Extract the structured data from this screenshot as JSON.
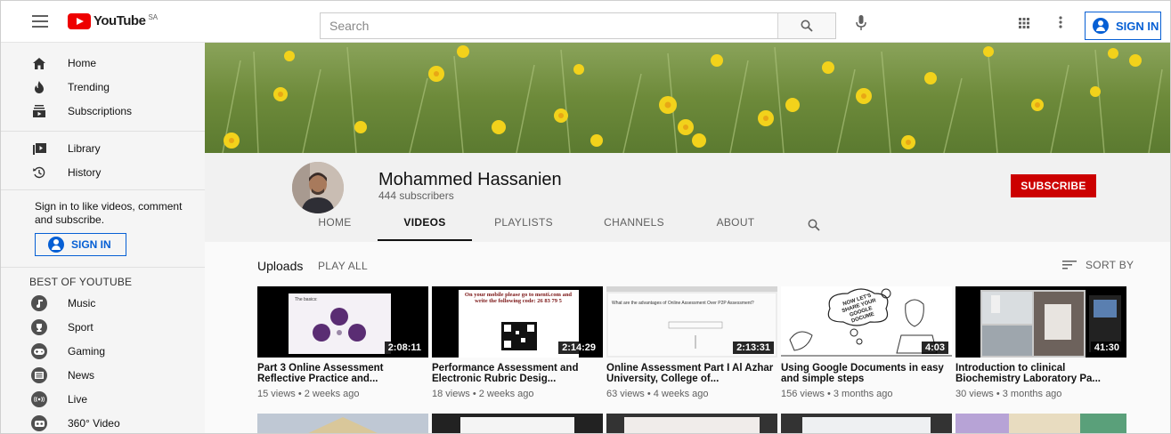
{
  "header": {
    "logo_text": "YouTube",
    "country_code": "SA",
    "search_placeholder": "Search",
    "signin_label": "SIGN IN"
  },
  "sidebar": {
    "main_items": [
      {
        "label": "Home",
        "icon": "home-icon"
      },
      {
        "label": "Trending",
        "icon": "flame-icon"
      },
      {
        "label": "Subscriptions",
        "icon": "subscriptions-icon"
      }
    ],
    "library_items": [
      {
        "label": "Library",
        "icon": "library-icon"
      },
      {
        "label": "History",
        "icon": "history-icon"
      }
    ],
    "signin_prompt": "Sign in to like videos, comment and subscribe.",
    "signin_label": "SIGN IN",
    "best_of_heading": "BEST OF YOUTUBE",
    "best_of_items": [
      {
        "label": "Music",
        "icon": "music-icon"
      },
      {
        "label": "Sport",
        "icon": "sport-icon"
      },
      {
        "label": "Gaming",
        "icon": "gaming-icon"
      },
      {
        "label": "News",
        "icon": "news-icon"
      },
      {
        "label": "Live",
        "icon": "live-icon"
      },
      {
        "label": "360° Video",
        "icon": "360-video-icon"
      }
    ]
  },
  "channel": {
    "name": "Mohammed Hassanien",
    "subscribers": "444 subscribers",
    "subscribe_label": "SUBSCRIBE",
    "tabs": [
      "HOME",
      "VIDEOS",
      "PLAYLISTS",
      "CHANNELS",
      "ABOUT"
    ],
    "active_tab": "VIDEOS"
  },
  "uploads": {
    "heading": "Uploads",
    "play_all": "PLAY ALL",
    "sort_by": "SORT BY",
    "videos": [
      {
        "title": "Part 3 Online Assessment Reflective Practice and...",
        "meta": "15 views • 2 weeks ago",
        "duration": "2:08:11",
        "thumb_text": "The basics:"
      },
      {
        "title": "Performance Assessment and Electronic Rubric Desig...",
        "meta": "18 views • 2 weeks ago",
        "duration": "2:14:29",
        "thumb_text": "On your mobile please go to menti.com and write the following code: 26 83 79 5"
      },
      {
        "title": "Online Assessment Part I Al Azhar University, College of...",
        "meta": "63 views • 4 weeks ago",
        "duration": "2:13:31",
        "thumb_text": "What are the advantages of Online Assessment Over P2P Assessment?"
      },
      {
        "title": "Using Google Documents in easy and simple steps",
        "meta": "156 views • 3 months ago",
        "duration": "4:03",
        "thumb_text": "NOW LET'S SHARE YOUR GOOGLE DOCUME"
      },
      {
        "title": "Introduction to clinical Biochemistry Laboratory Pa...",
        "meta": "30 views • 3 months ago",
        "duration": "41:30",
        "thumb_text": ""
      }
    ]
  },
  "colors": {
    "brand_red": "#ff0000",
    "subscribe_red": "#cc0000",
    "link_blue": "#065fd4"
  }
}
